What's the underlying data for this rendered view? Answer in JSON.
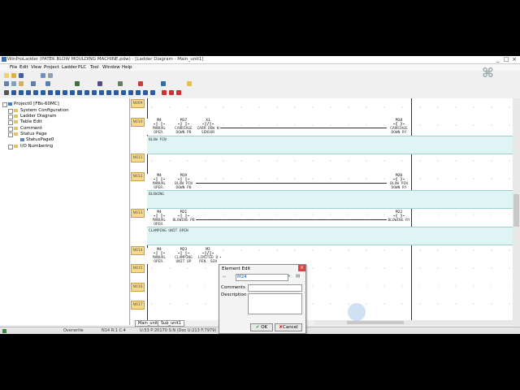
{
  "window": {
    "title": "WinProLadder (PATEK BLOW MOULDING MACHINE.pdw) - [Ladder Diagram - Main_unit1]",
    "controls": [
      "_",
      "□",
      "×"
    ]
  },
  "menu": [
    "File",
    "Edit",
    "View",
    "Project",
    "Ladder",
    "PLC",
    "Tool",
    "Window",
    "Help"
  ],
  "tree": {
    "root": "Project0 [FBs-60MC]",
    "items": [
      {
        "label": "System Configuration",
        "level": 1
      },
      {
        "label": "Ladder Diagram",
        "level": 1
      },
      {
        "label": "Table Edit",
        "level": 1
      },
      {
        "label": "Comment",
        "level": 1
      },
      {
        "label": "Status Page",
        "level": 1
      },
      {
        "label": "StatusPage0",
        "level": 2
      },
      {
        "label": "I/O Numbering",
        "level": 1
      }
    ]
  },
  "ladder": {
    "rung_numbers": [
      "N009",
      "N010",
      "N011",
      "N012",
      "N013",
      "N014",
      "N015",
      "N016",
      "N017"
    ],
    "rungs": [
      {
        "contacts": [
          {
            "addr": "M4",
            "label": "MANUAL OPER."
          },
          {
            "addr": "M17",
            "label": "CARRIAGE DOWN PB"
          },
          {
            "addr": "X1",
            "label": "CARR.DOW N SENSOR"
          }
        ],
        "coil": {
          "addr": "M18",
          "label": "CARRIAGE DOWN RY"
        },
        "comment": "BLOW PIN"
      },
      {
        "contacts": [
          {
            "addr": "M4",
            "label": "MANUAL OPER."
          },
          {
            "addr": "M19",
            "label": "BLOW PIN DOWN PB"
          }
        ],
        "coil": {
          "addr": "M20",
          "label": "BLOW PIN DOWN RY"
        },
        "comment": "BLOWING"
      },
      {
        "contacts": [
          {
            "addr": "M4",
            "label": "MANUAL OPER."
          },
          {
            "addr": "M21",
            "label": "BLOWING PB"
          }
        ],
        "coil": {
          "addr": "M22",
          "label": "BLOWING RY"
        },
        "comment": "CLAMPING UNIT OPEN"
      },
      {
        "contacts": [
          {
            "addr": "M4",
            "label": "MANUAL OPER."
          },
          {
            "addr": "M23",
            "label": "CLAMPING UNIT OP"
          },
          {
            "addr": "M2",
            "label": "LIMITED D PEN. SEN"
          }
        ],
        "coil": null,
        "comment": ""
      }
    ]
  },
  "sheet_tabs": [
    "Main_unit1",
    "Sub_unit1"
  ],
  "status": {
    "mode": "Overwrite",
    "position": "N14 R:1 C:4",
    "info": "U:53 P:20170 S:N (Doc U:213 F:7979)"
  },
  "dialog": {
    "title": "Element Edit",
    "element_value": "M24",
    "comments_label": "Comments",
    "description_label": "Description",
    "ok_label": "OK",
    "cancel_label": "Cancel"
  }
}
